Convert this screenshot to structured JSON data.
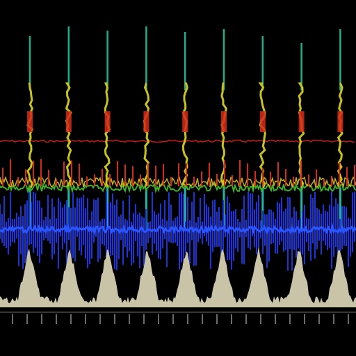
{
  "visualization": {
    "background_color": "#000000",
    "colors": {
      "spike_top": "#1fae8a",
      "spike_mid": "#c9c21a",
      "spike_low": "#d62a1a",
      "red_trace": "#b81d12",
      "green_band": "#3fae2a",
      "yellow_band": "#d8c21c",
      "blue_trace": "#1d34d8",
      "blue_bright": "#2a56ff",
      "cyan_spike": "#1fb7a7",
      "envelope": "#c9c4a8",
      "tick_line": "#6b6b6b"
    },
    "spike_count": 9
  }
}
